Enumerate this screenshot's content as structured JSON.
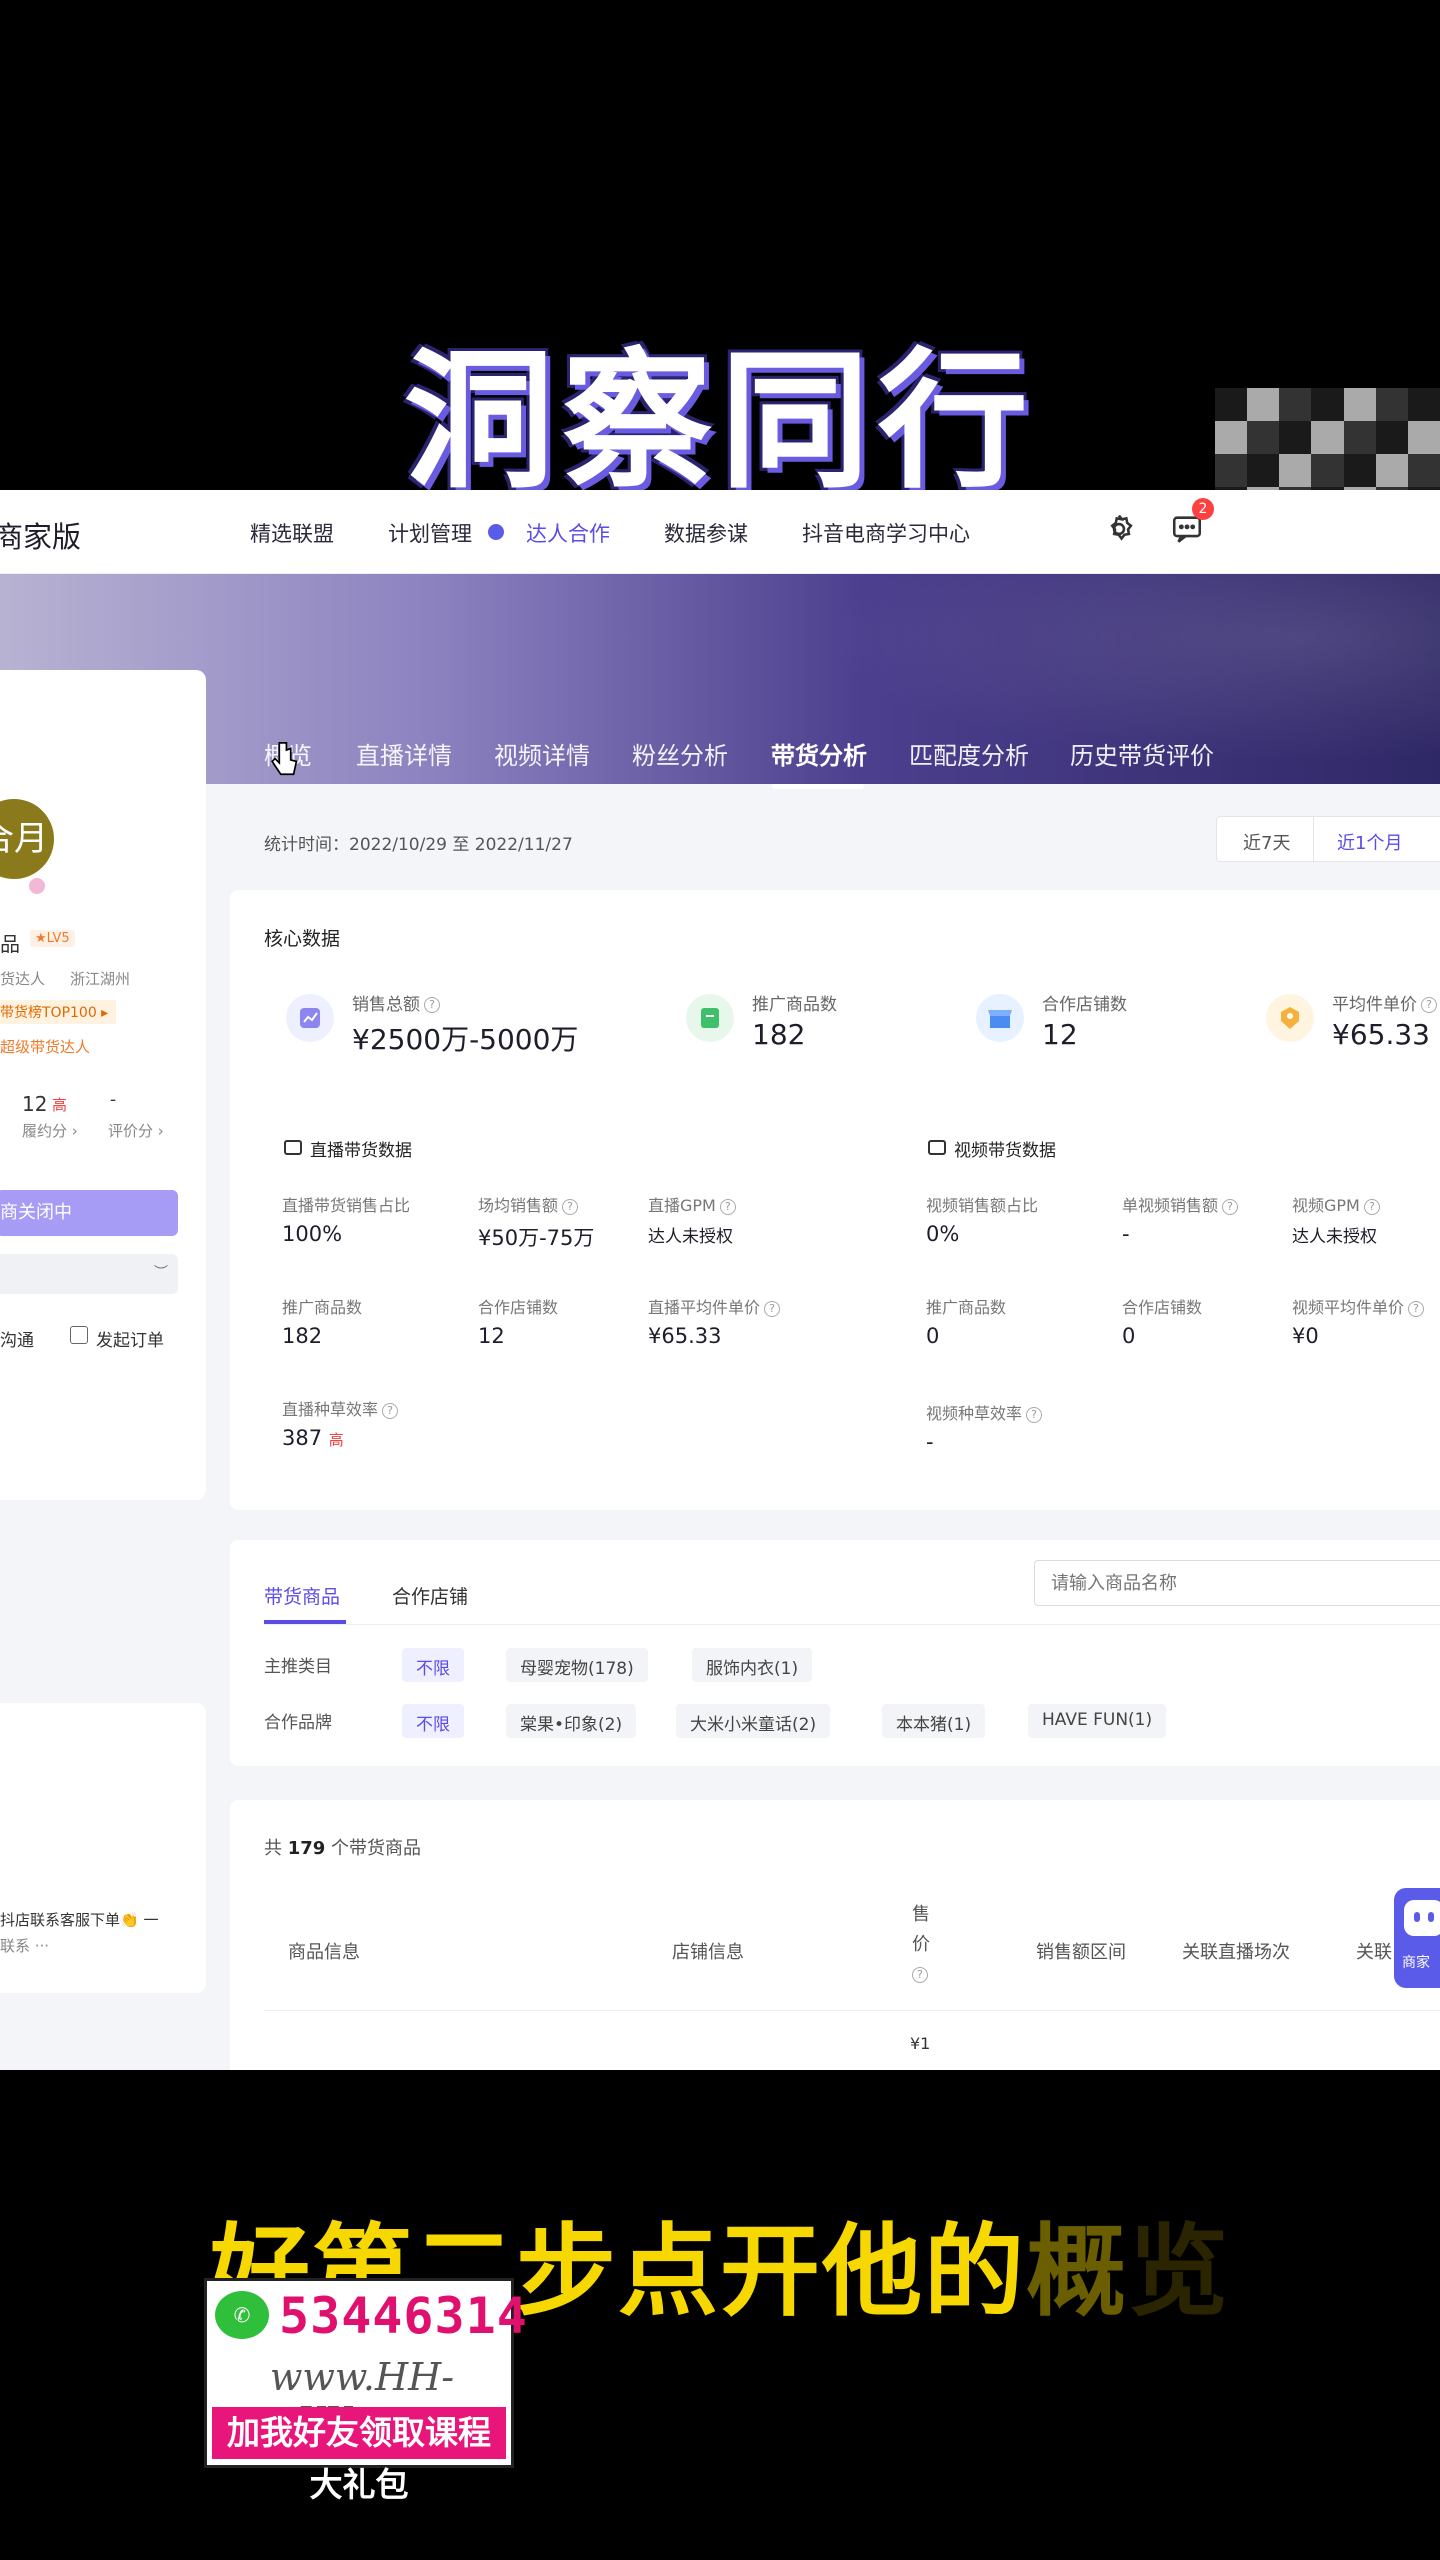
{
  "overlay": {
    "headline": "洞察同行",
    "subtitle_main": "好第二步点开他的",
    "subtitle_fade1": "概",
    "subtitle_fade2": "览",
    "promo": {
      "number": "53446314",
      "url": "www.HH-XX.net",
      "tagline": "加我好友领取课程大礼包",
      "icon": "wechat-icon"
    },
    "colors": {
      "headline": "#ffffff",
      "subtitle": "#f6d800",
      "promo_bar": "#e8157a"
    }
  },
  "topnav": {
    "brand": "商家版",
    "items": [
      "精选联盟",
      "计划管理",
      "达人合作",
      "数据参谋",
      "抖音电商学习中心"
    ],
    "active": "达人合作",
    "message_badge": "2"
  },
  "profile": {
    "avatar_text": "合月",
    "name": "品",
    "level": "★LV5",
    "role": "货达人",
    "region": "浙江湖州",
    "rank_badge": "带货榜TOP100 ▸",
    "tag": "超级带货达人",
    "score_value": "12",
    "score_hot": "高",
    "score_dash": "-",
    "score_label_1": "履约分 ›",
    "score_label_2": "评价分 ›",
    "status_button": "商关闭中",
    "contact": "沟通",
    "order": "发起订单",
    "note_line1": "抖店联系客服下单👏 一",
    "note_line2": "联系 ···"
  },
  "tabs": {
    "items": [
      "概览",
      "直播详情",
      "视频详情",
      "粉丝分析",
      "带货分析",
      "匹配度分析",
      "历史带货评价"
    ],
    "active": "带货分析"
  },
  "stat": {
    "time": "统计时间：2022/10/29 至 2022/11/27",
    "range_7": "近7天",
    "range_30": "近1个月",
    "active_range": "近1个月"
  },
  "core": {
    "title": "核心数据",
    "kpis": [
      {
        "label": "销售总额",
        "value": "¥2500万-5000万",
        "icon": "sales-chart-icon",
        "color": "#eef0ff"
      },
      {
        "label": "推广商品数",
        "value": "182",
        "icon": "product-icon",
        "color": "#e8f7ec"
      },
      {
        "label": "合作店铺数",
        "value": "12",
        "icon": "shop-icon",
        "color": "#e8f1ff"
      },
      {
        "label": "平均件单价",
        "value": "¥65.33",
        "icon": "price-tag-icon",
        "color": "#fff4e0"
      }
    ],
    "live": {
      "title": "直播带货数据",
      "metrics": [
        {
          "label": "直播带货销售占比",
          "value": "100%"
        },
        {
          "label": "场均销售额",
          "value": "¥50万-75万"
        },
        {
          "label": "直播GPM",
          "value": "达人未授权"
        },
        {
          "label": "推广商品数",
          "value": "182"
        },
        {
          "label": "合作店铺数",
          "value": "12"
        },
        {
          "label": "直播平均件单价",
          "value": "¥65.33"
        },
        {
          "label": "直播种草效率",
          "value": "387",
          "hot": "高"
        }
      ]
    },
    "video": {
      "title": "视频带货数据",
      "metrics": [
        {
          "label": "视频销售额占比",
          "value": "0%"
        },
        {
          "label": "单视频销售额",
          "value": "-"
        },
        {
          "label": "视频GPM",
          "value": "达人未授权"
        },
        {
          "label": "推广商品数",
          "value": "0"
        },
        {
          "label": "合作店铺数",
          "value": "0"
        },
        {
          "label": "视频平均件单价",
          "value": "¥0"
        },
        {
          "label": "视频种草效率",
          "value": "-"
        }
      ]
    }
  },
  "products": {
    "tab_goods": "带货商品",
    "tab_shops": "合作店铺",
    "search_placeholder": "请输入商品名称",
    "category_label": "主推类目",
    "categories": [
      "不限",
      "母婴宠物(178)",
      "服饰内衣(1)"
    ],
    "brand_label": "合作品牌",
    "brands": [
      "不限",
      "棠果•印象(2)",
      "大米小米童话(2)",
      "本本猪(1)",
      "HAVE FUN(1)"
    ],
    "count_prefix": "共",
    "count": "179",
    "count_suffix": "个带货商品",
    "columns": [
      "商品信息",
      "店铺信息",
      "售价",
      "销售额区间",
      "关联直播场次",
      "关联"
    ],
    "first_price": "¥1"
  },
  "assistant": {
    "label": "商家"
  }
}
